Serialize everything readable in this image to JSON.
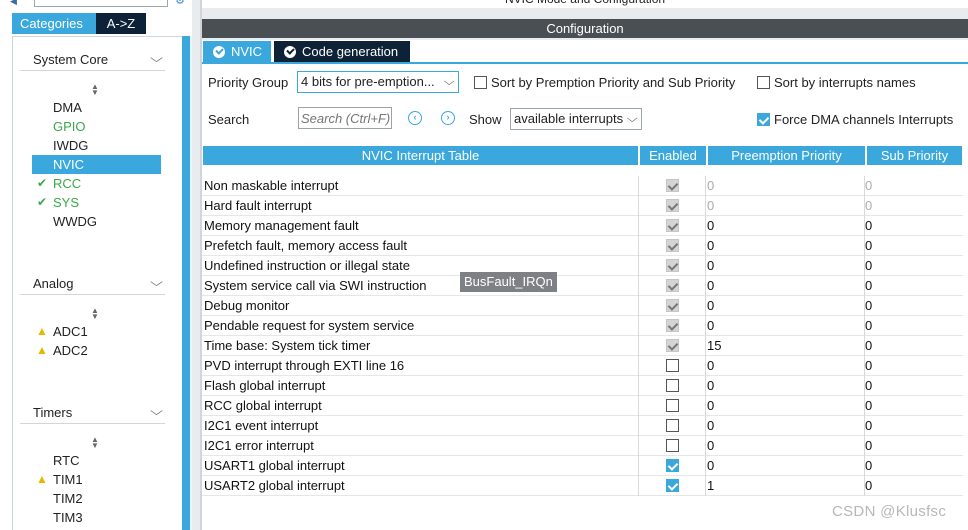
{
  "header": {
    "mode_title": "NVIC Mode and Configuration",
    "config_title": "Configuration"
  },
  "left_panel": {
    "tabs": [
      "Categories",
      "A->Z"
    ],
    "groups": [
      {
        "title": "System Core",
        "items": [
          {
            "label": "DMA",
            "status": "none"
          },
          {
            "label": "GPIO",
            "status": "green"
          },
          {
            "label": "IWDG",
            "status": "none"
          },
          {
            "label": "NVIC",
            "status": "selected"
          },
          {
            "label": "RCC",
            "status": "check"
          },
          {
            "label": "SYS",
            "status": "check"
          },
          {
            "label": "WWDG",
            "status": "none"
          }
        ]
      },
      {
        "title": "Analog",
        "items": [
          {
            "label": "ADC1",
            "status": "warning"
          },
          {
            "label": "ADC2",
            "status": "warning"
          }
        ]
      },
      {
        "title": "Timers",
        "items": [
          {
            "label": "RTC",
            "status": "none"
          },
          {
            "label": "TIM1",
            "status": "warning"
          },
          {
            "label": "TIM2",
            "status": "none"
          },
          {
            "label": "TIM3",
            "status": "none"
          }
        ]
      }
    ]
  },
  "sub_tabs": [
    "NVIC",
    "Code generation"
  ],
  "options": {
    "priority_group_label": "Priority Group",
    "priority_group_value": "4 bits for pre-emption...",
    "sort_premption_label": "Sort by Premption Priority and Sub Priority",
    "sort_premption_checked": false,
    "sort_names_label": "Sort by interrupts names",
    "sort_names_checked": false,
    "search_label": "Search",
    "search_placeholder": "Search (Ctrl+F)",
    "show_label": "Show",
    "show_value": "available interrupts",
    "force_dma_label": "Force DMA channels Interrupts",
    "force_dma_checked": true
  },
  "table": {
    "columns": [
      "NVIC Interrupt Table",
      "Enabled",
      "Preemption Priority",
      "Sub Priority"
    ],
    "rows": [
      {
        "name": "Non maskable interrupt",
        "enabled": "locked",
        "preemption": "0",
        "sub": "0",
        "dim": true
      },
      {
        "name": "Hard fault interrupt",
        "enabled": "locked",
        "preemption": "0",
        "sub": "0",
        "dim": true
      },
      {
        "name": "Memory management fault",
        "enabled": "locked",
        "preemption": "0",
        "sub": "0",
        "dim": false
      },
      {
        "name": "Prefetch fault, memory access fault",
        "enabled": "locked",
        "preemption": "0",
        "sub": "0",
        "dim": false
      },
      {
        "name": "Undefined instruction or illegal state",
        "enabled": "locked",
        "preemption": "0",
        "sub": "0",
        "dim": false
      },
      {
        "name": "System service call via SWI instruction",
        "enabled": "locked",
        "preemption": "0",
        "sub": "0",
        "dim": false
      },
      {
        "name": "Debug monitor",
        "enabled": "locked",
        "preemption": "0",
        "sub": "0",
        "dim": false
      },
      {
        "name": "Pendable request for system service",
        "enabled": "locked",
        "preemption": "0",
        "sub": "0",
        "dim": false
      },
      {
        "name": "Time base: System tick timer",
        "enabled": "locked",
        "preemption": "15",
        "sub": "0",
        "dim": false
      },
      {
        "name": "PVD interrupt through EXTI line 16",
        "enabled": "off",
        "preemption": "0",
        "sub": "0",
        "dim": false
      },
      {
        "name": "Flash global interrupt",
        "enabled": "off",
        "preemption": "0",
        "sub": "0",
        "dim": false
      },
      {
        "name": "RCC global interrupt",
        "enabled": "off",
        "preemption": "0",
        "sub": "0",
        "dim": false
      },
      {
        "name": "I2C1 event interrupt",
        "enabled": "off",
        "preemption": "0",
        "sub": "0",
        "dim": false
      },
      {
        "name": "I2C1 error interrupt",
        "enabled": "off",
        "preemption": "0",
        "sub": "0",
        "dim": false
      },
      {
        "name": "USART1 global interrupt",
        "enabled": "on",
        "preemption": "0",
        "sub": "0",
        "dim": false
      },
      {
        "name": "USART2 global interrupt",
        "enabled": "on",
        "preemption": "1",
        "sub": "0",
        "dim": false
      }
    ]
  },
  "tooltip": "BusFault_IRQn",
  "watermark": "CSDN @Klusfsc",
  "colors": {
    "accent": "#3aa8dc",
    "dark_tab": "#0d2236",
    "config_bar": "#4a4f53",
    "ok_green": "#3aa84a",
    "warning": "#e6b800"
  }
}
